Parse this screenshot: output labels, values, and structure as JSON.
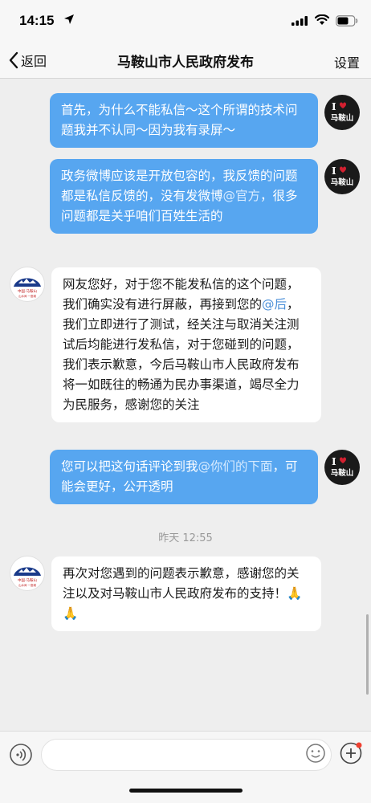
{
  "status_bar": {
    "time": "14:15"
  },
  "nav": {
    "back_label": "返回",
    "title": "马鞍山市人民政府发布",
    "settings_label": "设置"
  },
  "user_avatar": {
    "line1": "I",
    "line2": "马鞍山"
  },
  "gov_avatar": {
    "line1": "中国·马鞍山",
    "line2": "山水间 一座城"
  },
  "messages": [
    {
      "text": "首先，为什么不能私信～这个所谓的技术问题我并不认同～因为我有录屏～"
    },
    {
      "text_before": "政务微博应该是开放包容的，我反馈的问题都是私信反馈的，没有发微博",
      "mention": "@官方",
      "text_after": "，很多问题都是关乎咱们百姓生活的"
    },
    {
      "text_before": "网友您好，对于您不能发私信的这个问题，我们确实没有进行屏蔽，再接到您的",
      "mention": "@后",
      "text_after": "，我们立即进行了测试，经关注与取消关注测试后均能进行发私信，对于您碰到的问题，我们表示歉意，今后马鞍山市人民政府发布将一如既往的畅通为民办事渠道，竭尽全力为民服务，感谢您的关注"
    },
    {
      "text_before": "您可以把这句话评论到我",
      "mention": "@你们的下面",
      "text_after": "，可能会更好，公开透明"
    },
    {
      "text": "再次对您遇到的问题表示歉意，感谢您的关注以及对马鞍山市人民政府发布的支持！🙏🙏"
    }
  ],
  "timestamp": "昨天 12:55",
  "colors": {
    "out_bubble": "#57a6f0",
    "in_bubble": "#ffffff",
    "background": "#eeeeee"
  }
}
